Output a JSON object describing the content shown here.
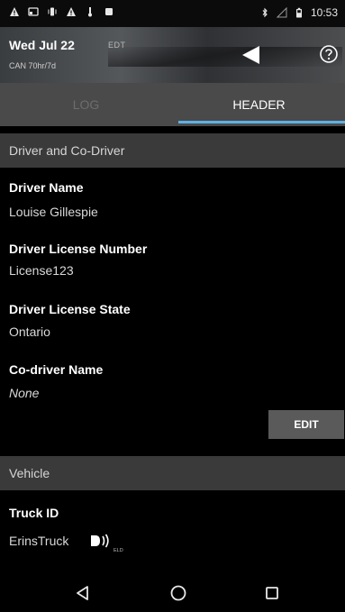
{
  "status_bar": {
    "time": "10:53",
    "left_icons": [
      "warning-icon",
      "cast-icon",
      "vibrate-icon",
      "warning-icon",
      "thermometer-icon",
      "notification-icon"
    ],
    "right_icons": [
      "bluetooth-icon",
      "signal-icon",
      "battery-icon"
    ]
  },
  "header": {
    "date": "Wed Jul 22",
    "timezone": "EDT",
    "cycle": "CAN 70hr/7d"
  },
  "tabs": [
    {
      "label": "LOG",
      "active": false
    },
    {
      "label": "HEADER",
      "active": true
    }
  ],
  "sections": {
    "driver": {
      "title": "Driver and Co-Driver",
      "fields": [
        {
          "label": "Driver Name",
          "value": "Louise Gillespie"
        },
        {
          "label": "Driver License Number",
          "value": "License123"
        },
        {
          "label": "Driver License State",
          "value": "Ontario"
        },
        {
          "label": "Co-driver Name",
          "value": "None"
        }
      ],
      "edit_label": "EDIT"
    },
    "vehicle": {
      "title": "Vehicle",
      "fields": [
        {
          "label": "Truck ID",
          "value": "ErinsTruck"
        }
      ],
      "eld_badge": "ELD"
    }
  },
  "colors": {
    "accent": "#5fb1e4",
    "tab_bar": "#4a4a4a",
    "section_bg": "#3a3a3a",
    "button_bg": "#5a5a5a"
  }
}
